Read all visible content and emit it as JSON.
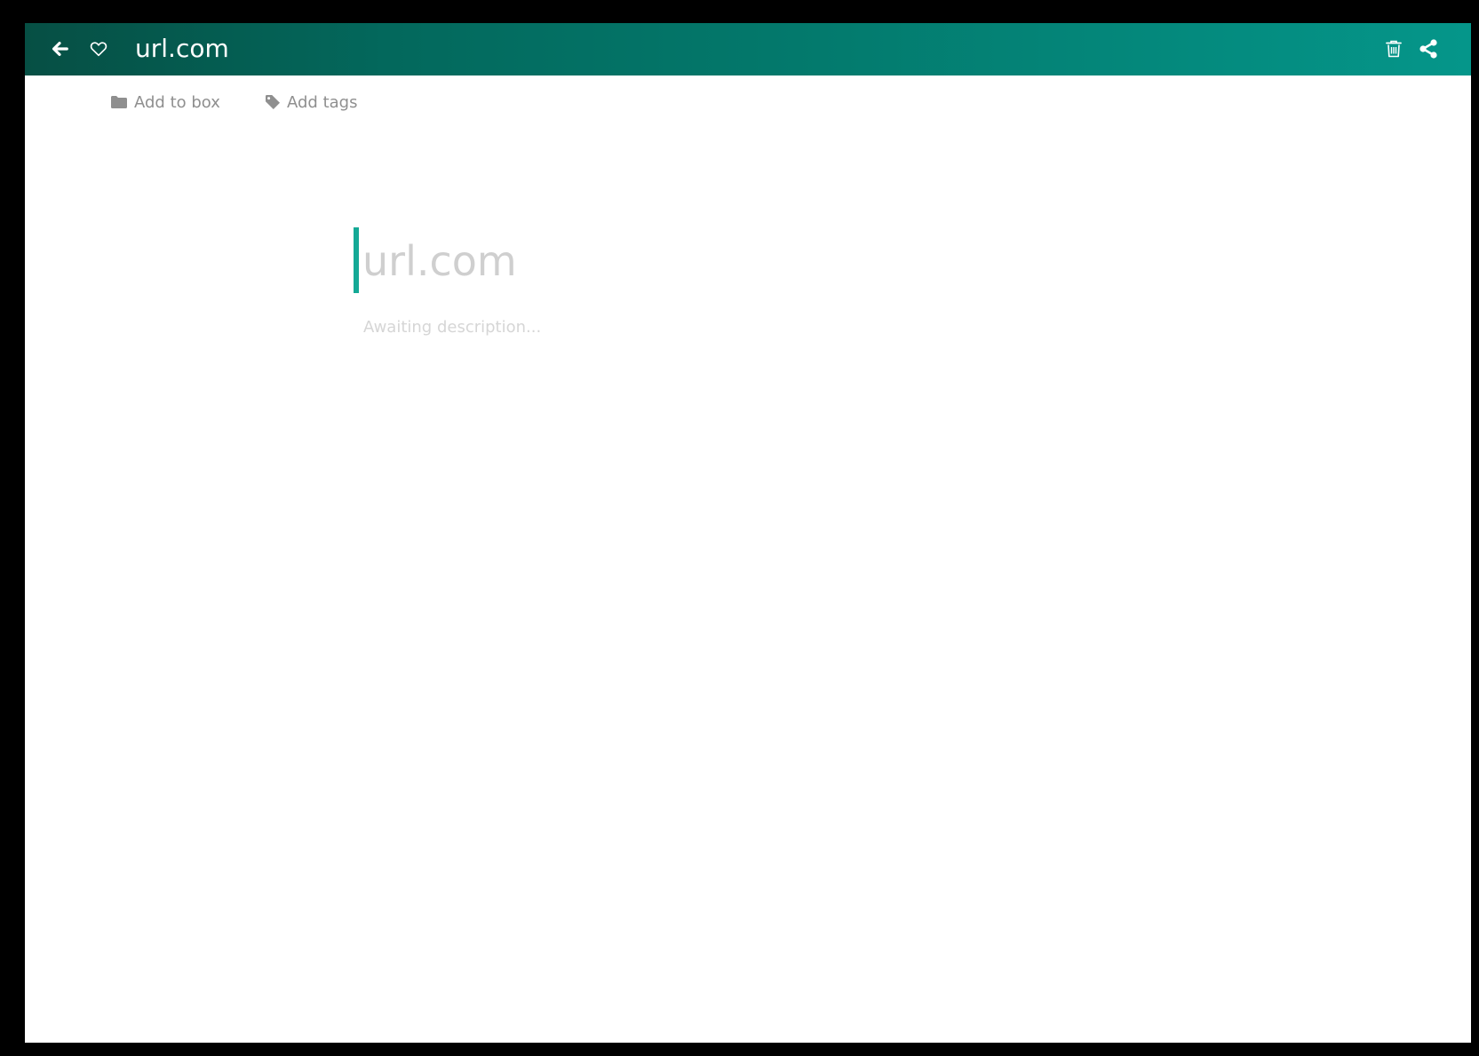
{
  "appbar": {
    "title": "url.com",
    "icons": {
      "back": "arrow-left-icon",
      "favorite": "heart-outline-icon",
      "delete": "trash-icon",
      "share": "share-icon"
    },
    "gradient_colors": [
      "#064f44",
      "#05968a"
    ]
  },
  "actions": {
    "add_to_box": {
      "label": "Add to box",
      "icon": "folder-icon"
    },
    "add_tags": {
      "label": "Add tags",
      "icon": "tag-icon"
    }
  },
  "editor": {
    "title_value": "",
    "title_placeholder": "url.com",
    "description_value": "",
    "description_placeholder": "Awaiting description...",
    "accent_color": "#14a996"
  }
}
